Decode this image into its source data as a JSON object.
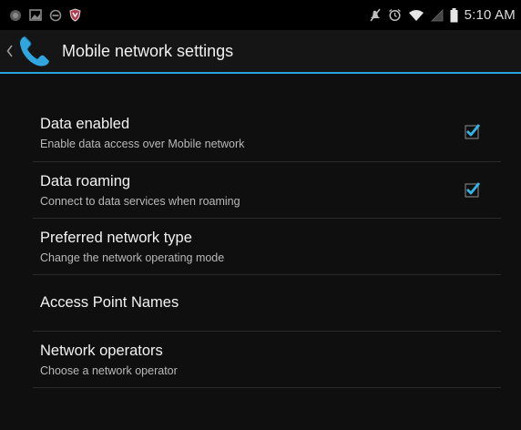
{
  "status_bar": {
    "left_icons": [
      "android-icon",
      "image-notification-icon",
      "blocked-icon",
      "shield-icon"
    ],
    "right_icons": [
      "mute-icon",
      "alarm-icon",
      "wifi-icon",
      "signal-icon",
      "battery-icon"
    ],
    "time": "5:10 AM"
  },
  "action_bar": {
    "title": "Mobile network settings",
    "accent_color": "#29a3d9",
    "app_icon": "phone-icon"
  },
  "preferences": [
    {
      "title": "Data enabled",
      "summary": "Enable data access over Mobile network",
      "checkbox": true,
      "checked": true
    },
    {
      "title": "Data roaming",
      "summary": "Connect to data services when roaming",
      "checkbox": true,
      "checked": true
    },
    {
      "title": "Preferred network type",
      "summary": "Change the network operating mode",
      "checkbox": false
    },
    {
      "title": "Access Point Names",
      "summary": "",
      "checkbox": false
    },
    {
      "title": "Network operators",
      "summary": "Choose a network operator",
      "checkbox": false
    }
  ]
}
